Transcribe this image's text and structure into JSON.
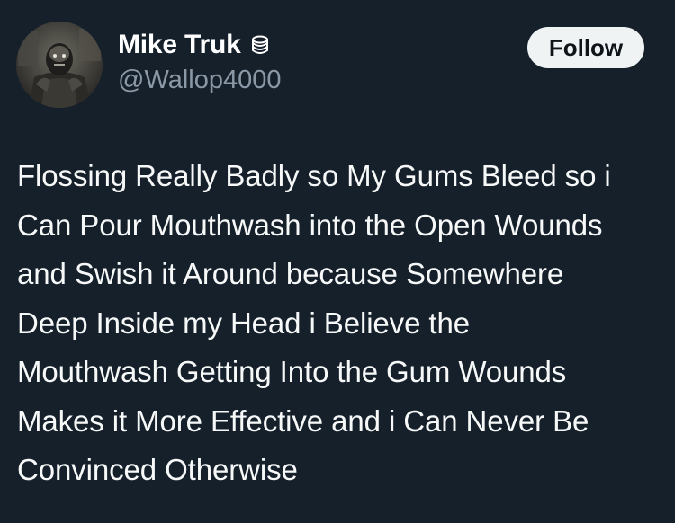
{
  "author": {
    "display_name": "Mike Truk",
    "handle": "@Wallop4000",
    "badge_icon": "stack-coins-icon"
  },
  "actions": {
    "follow_label": "Follow"
  },
  "tweet": {
    "lines": [
      "Flossing Really Badly so My Gums Bleed so i",
      "Can Pour Mouthwash into the Open Wounds",
      "and Swish it Around because Somewhere",
      "Deep Inside my Head i Believe the",
      "Mouthwash Getting Into the Gum Wounds",
      "Makes it More Effective and i Can Never Be",
      "Convinced Otherwise"
    ]
  },
  "colors": {
    "background": "#15202b",
    "text": "#f7f9f9",
    "secondary_text": "#8b98a5",
    "follow_bg": "#eff3f4",
    "follow_text": "#0f1419"
  }
}
